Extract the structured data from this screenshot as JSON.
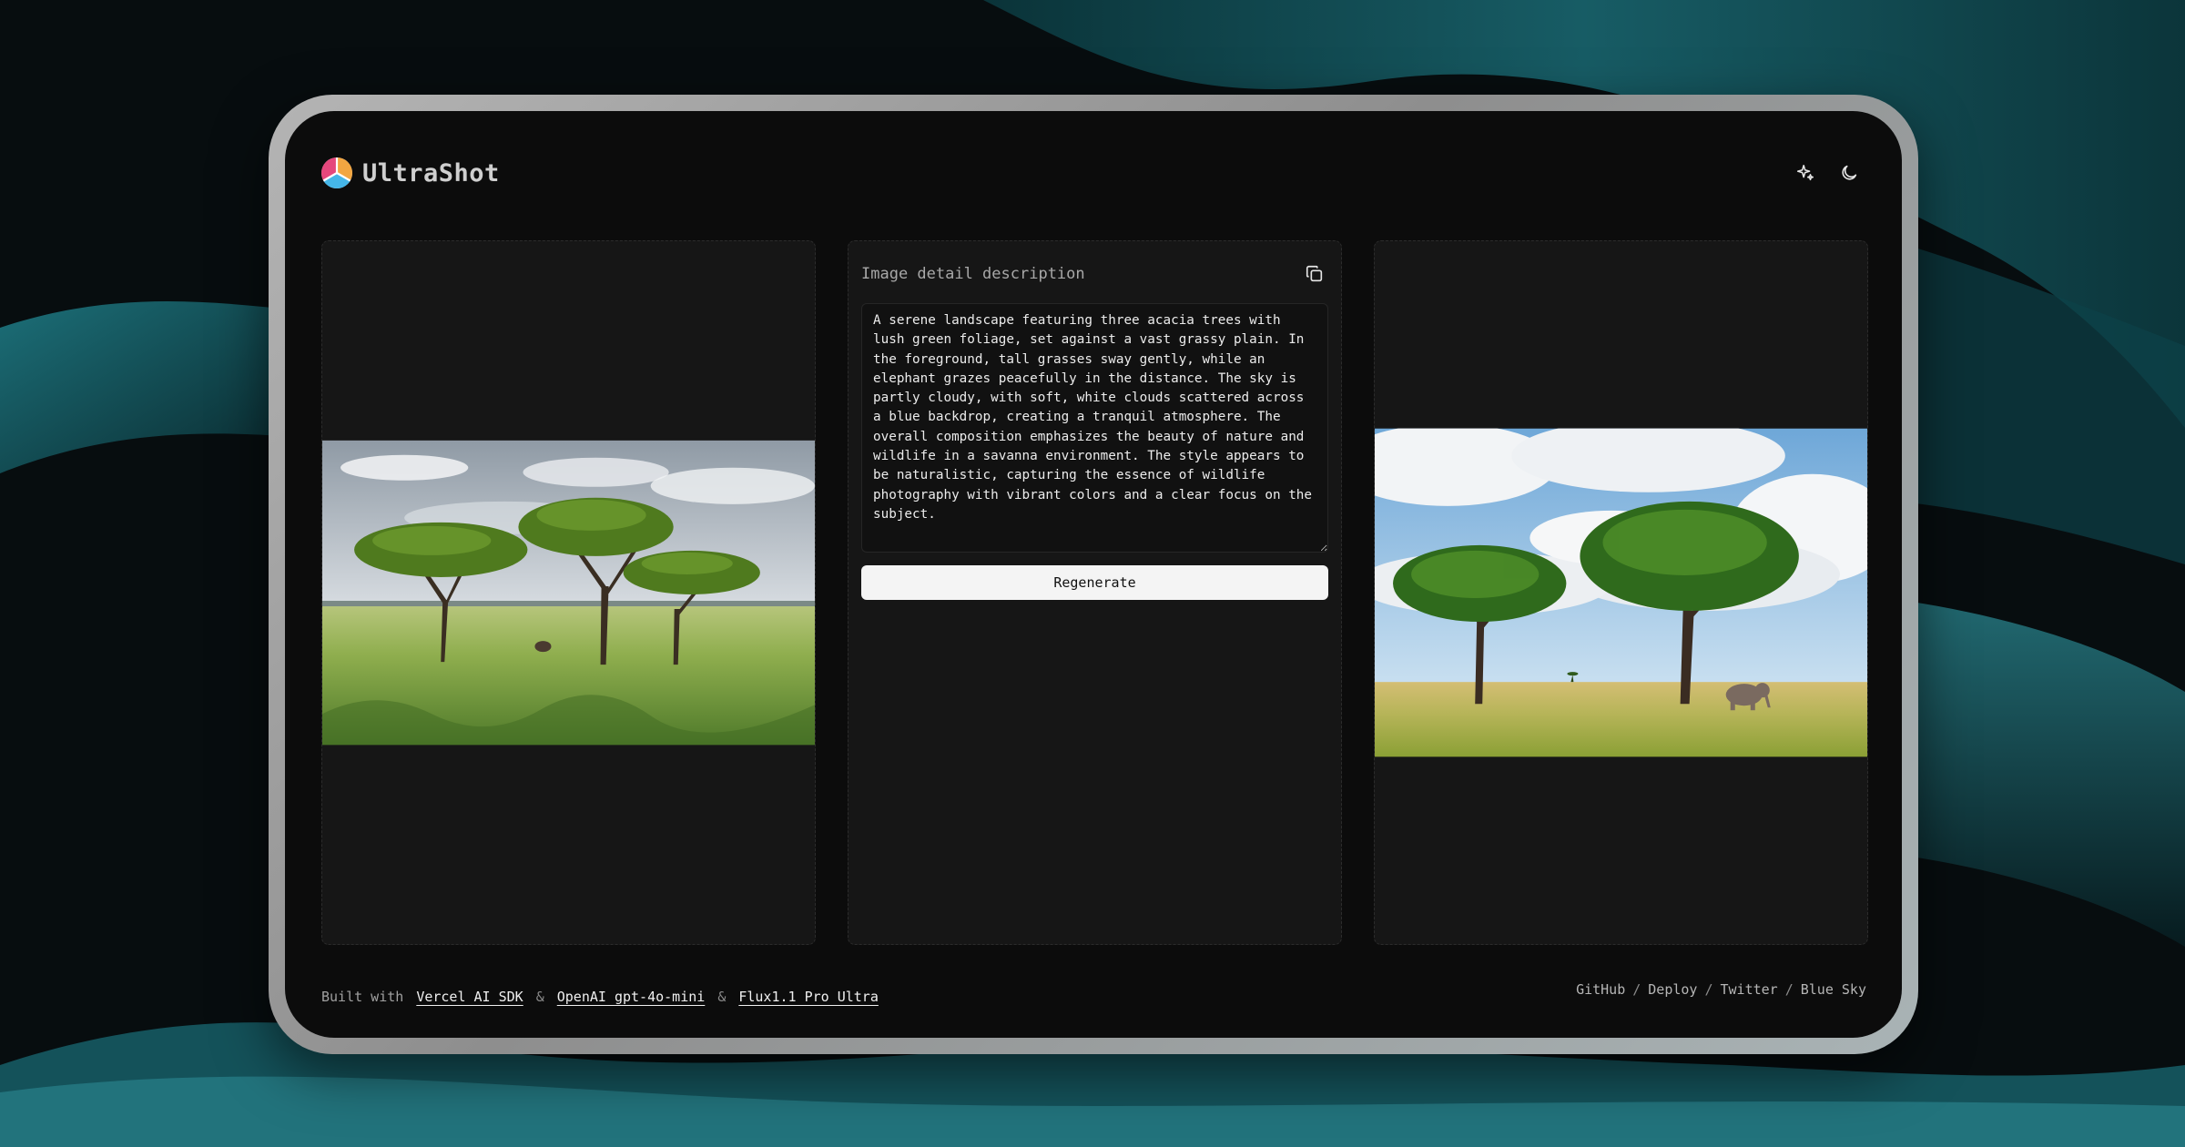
{
  "app": {
    "name": "UltraShot",
    "logo_icon": "ultrashot-logo-icon"
  },
  "header": {
    "actions": [
      {
        "icon": "sparkle-icon",
        "label": ""
      },
      {
        "icon": "moon-icon",
        "label": ""
      }
    ]
  },
  "original_image": {
    "alt": "",
    "icon": "savanna-photo"
  },
  "description": {
    "title": "Image detail description",
    "copy_icon": "copy-icon",
    "text": "A serene landscape featuring three acacia trees with lush green foliage, set against a vast grassy plain. In the foreground, tall grasses sway gently, while an elephant grazes peacefully in the distance. The sky is partly cloudy, with soft, white clouds scattered across a blue backdrop, creating a tranquil atmosphere. The overall composition emphasizes the beauty of nature and wildlife in a savanna environment. The style appears to be naturalistic, capturing the essence of wildlife photography with vibrant colors and a clear focus on the subject.",
    "button_label": "Regenerate"
  },
  "generated_image": {
    "alt": "",
    "icon": "savanna-photo"
  },
  "footer": {
    "built_with": "Built with",
    "and": "&",
    "links": [
      "Vercel AI SDK",
      "OpenAI gpt-4o-mini",
      "Flux1.1 Pro Ultra"
    ],
    "right_links": [
      "GitHub",
      "Deploy",
      "Twitter",
      "Blue Sky"
    ],
    "right_sep": "/"
  },
  "colors": {
    "background": "#071113",
    "screen": "#0c0c0c",
    "panel": "#161616",
    "button_bg": "#f4f4f4",
    "accent_teal": "#1b6e78"
  }
}
